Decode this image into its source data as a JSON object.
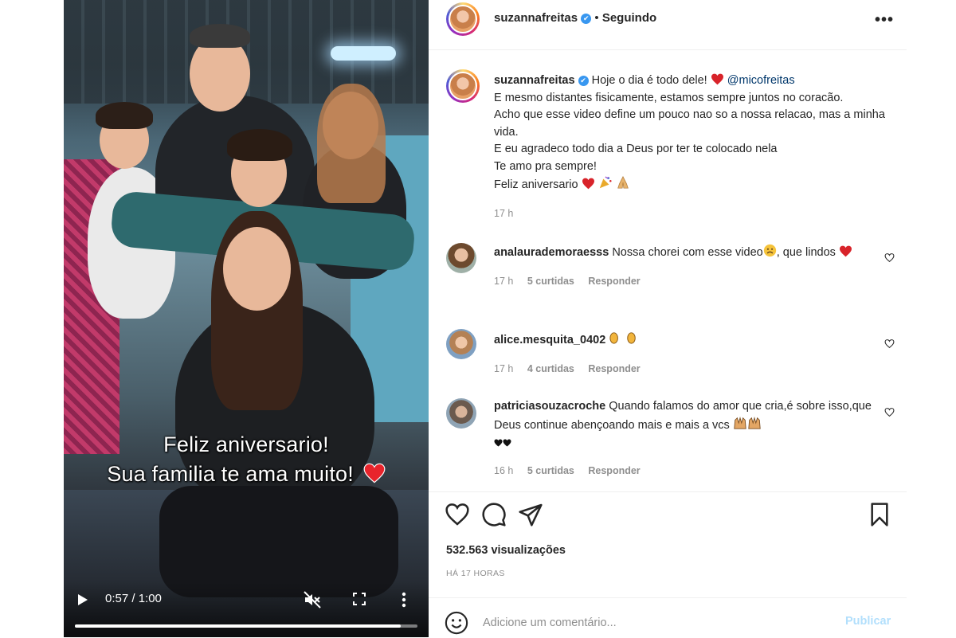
{
  "video": {
    "overlay_line1": "Feliz aniversario!",
    "overlay_line2": "Sua familia te ama muito!",
    "time": "0:57 / 1:00",
    "progress": 0.95
  },
  "header": {
    "username": "suzannafreitas",
    "verified_symbol": "✔",
    "separator": "•",
    "follow_label": "Seguindo",
    "more_label": "•••"
  },
  "caption": {
    "username": "suzannafreitas",
    "line1": "Hoje o dia é todo dele!",
    "mention": "@micofreitas",
    "line2": "E mesmo distantes fisicamente, estamos sempre juntos no coracão.",
    "line3": "Acho que esse video define um pouco nao so a nossa relacao, mas a minha vida.",
    "line4": "E eu agradeco todo dia a Deus por ter te colocado nela",
    "line5": "Te amo pra sempre!",
    "line6": "Feliz aniversario",
    "time": "17 h"
  },
  "comments": [
    {
      "username": "analaurademoraesss",
      "text_before": "Nossa chorei com esse video",
      "text_after": ", que lindos",
      "time": "17 h",
      "likes": "5 curtidas",
      "reply": "Responder"
    },
    {
      "username": "alice.mesquita_0402",
      "text_before": "",
      "text_after": "",
      "time": "17 h",
      "likes": "4 curtidas",
      "reply": "Responder"
    },
    {
      "username": "patriciasouzacroche",
      "text_before": "Quando falamos do amor que cria,é sobre isso,que Deus continue abençoando mais e mais a vcs",
      "text_after": "",
      "time": "16 h",
      "likes": "5 curtidas",
      "reply": "Responder"
    }
  ],
  "stats": {
    "views": "532.563 visualizações",
    "ago": "HÁ 17 HORAS"
  },
  "add_comment": {
    "placeholder": "Adicione um comentário...",
    "publish_label": "Publicar"
  },
  "icons": [
    "play-icon",
    "mute-icon",
    "fullscreen-icon",
    "more-vertical-icon",
    "verified-icon",
    "more-horizontal-icon",
    "heart-icon",
    "comment-icon",
    "share-icon",
    "bookmark-icon",
    "emoji-icon"
  ],
  "colors": {
    "accent_blue": "#3897f0",
    "mention": "#00376b",
    "muted": "#8e8e8e",
    "publish_disabled": "#b2dffc",
    "heart_red": "#e0245e"
  }
}
